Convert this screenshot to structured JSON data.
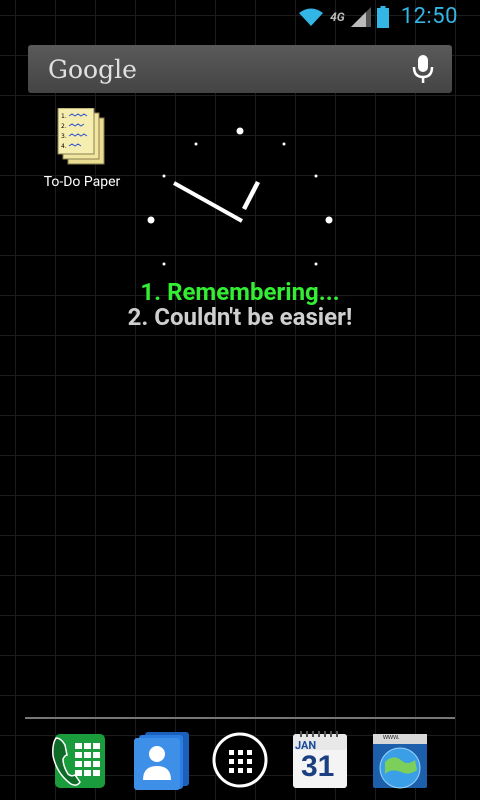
{
  "status_bar": {
    "network": "4G",
    "time": "12:50",
    "accent_color": "#33b5e5"
  },
  "search": {
    "label": "Google"
  },
  "apps": [
    {
      "label": "To-Do Paper",
      "icon": "notepad-icon"
    }
  ],
  "widget": {
    "line1": "1. Remembering...",
    "line2": "2. Couldn't be easier!",
    "line1_color": "#33ee33"
  },
  "dock": [
    {
      "name": "phone",
      "icon": "phone-icon"
    },
    {
      "name": "contacts",
      "icon": "contacts-icon"
    },
    {
      "name": "app-drawer",
      "icon": "app-drawer-icon"
    },
    {
      "name": "calendar",
      "icon": "calendar-icon",
      "month": "JAN",
      "day": "31"
    },
    {
      "name": "browser",
      "icon": "browser-icon",
      "address": "www."
    }
  ]
}
